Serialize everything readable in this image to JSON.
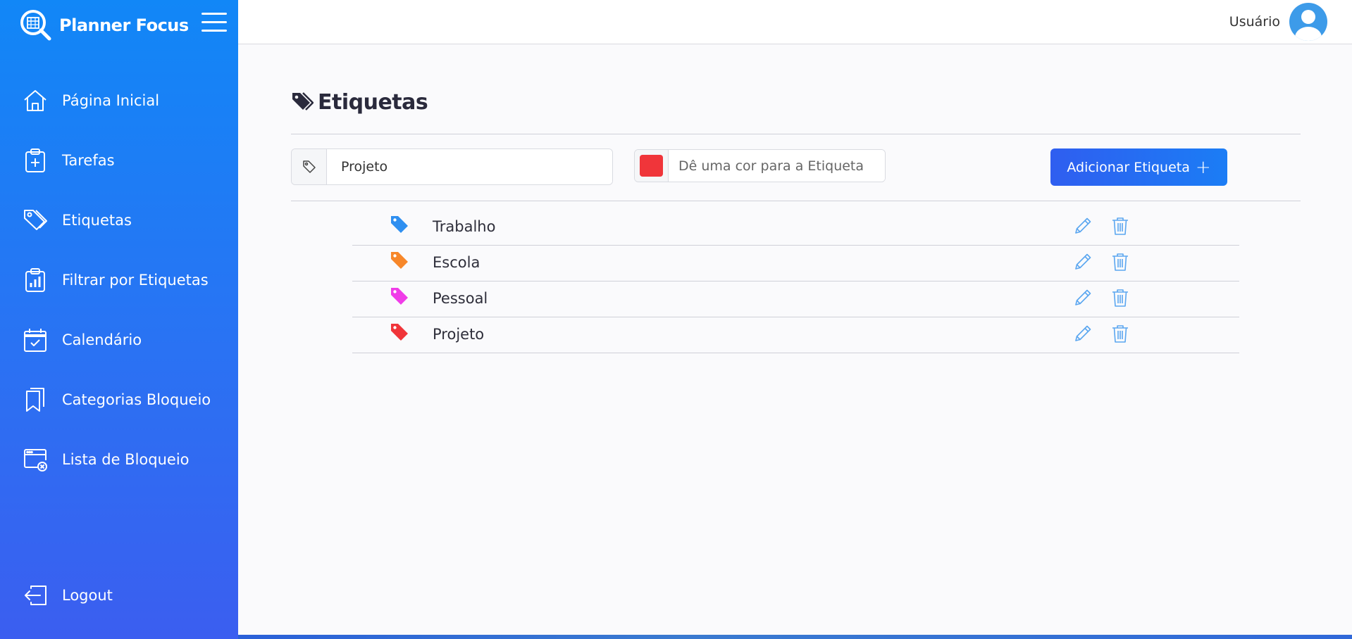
{
  "sidebar": {
    "brand": "Planner Focus",
    "items": [
      {
        "label": "Página Inicial",
        "icon": "home-icon"
      },
      {
        "label": "Tarefas",
        "icon": "clipboard-plus-icon"
      },
      {
        "label": "Etiquetas",
        "icon": "tags-icon"
      },
      {
        "label": "Filtrar por Etiquetas",
        "icon": "clipboard-chart-icon"
      },
      {
        "label": "Calendário",
        "icon": "calendar-check-icon"
      },
      {
        "label": "Categorias Bloqueio",
        "icon": "bookmarks-icon"
      },
      {
        "label": "Lista de Bloqueio",
        "icon": "window-block-icon"
      }
    ],
    "logout": "Logout"
  },
  "topbar": {
    "user_name": "Usuário"
  },
  "main": {
    "title": "Etiquetas",
    "form": {
      "name_value": "Projeto",
      "color_placeholder": "Dê uma cor para a Etiqueta",
      "selected_color": "#f0353a",
      "add_button": "Adicionar Etiqueta",
      "add_button_icon": "+"
    },
    "tags": [
      {
        "name": "Trabalho",
        "color": "#2f8ff0"
      },
      {
        "name": "Escola",
        "color": "#f7872a"
      },
      {
        "name": "Pessoal",
        "color": "#f03ce8"
      },
      {
        "name": "Projeto",
        "color": "#f0353a"
      }
    ]
  },
  "colors": {
    "sidebar_top": "#1187f7",
    "sidebar_bottom": "#3b5ef0",
    "accent": "#2f5ef0",
    "icon_action": "#5aa6f0"
  }
}
